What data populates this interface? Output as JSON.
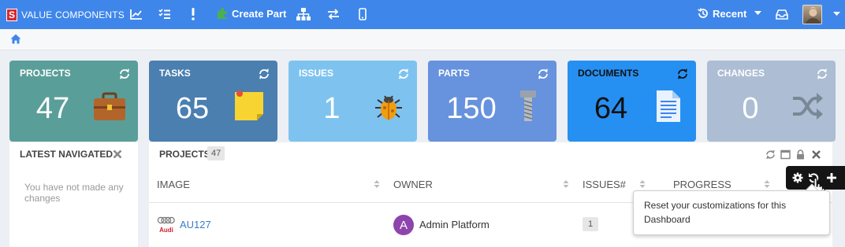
{
  "topbar": {
    "brand": "VALUE COMPONENTS",
    "logo_letter": "S",
    "create_part": "Create Part",
    "recent": "Recent"
  },
  "tiles": [
    {
      "title": "PROJECTS",
      "value": "47",
      "color": "#5a9e9a",
      "icon": "briefcase-icon"
    },
    {
      "title": "TASKS",
      "value": "65",
      "color": "#4a7fb0",
      "icon": "sticky-note-icon"
    },
    {
      "title": "ISSUES",
      "value": "1",
      "color": "#7ec3ef",
      "icon": "bug-icon"
    },
    {
      "title": "PARTS",
      "value": "150",
      "color": "#6792dd",
      "icon": "bolt-icon"
    },
    {
      "title": "DOCUMENTS",
      "value": "64",
      "color": "#2690f2",
      "icon": "document-icon"
    },
    {
      "title": "CHANGES",
      "value": "0",
      "color": "#acbdd4",
      "icon": "shuffle-icon"
    }
  ],
  "latest_navigated": {
    "title": "LATEST NAVIGATED",
    "empty_text": "You have not made any changes"
  },
  "projects_panel": {
    "title": "PROJECTS",
    "count": "47",
    "columns": [
      "IMAGE",
      "OWNER",
      "ISSUES#",
      "PROGRESS"
    ],
    "rows": [
      {
        "name": "AU127",
        "owner": "Admin Platform",
        "owner_initial": "A",
        "issues": "1"
      }
    ]
  },
  "tooltip": {
    "text": "Reset your customizations for this Dashboard"
  }
}
